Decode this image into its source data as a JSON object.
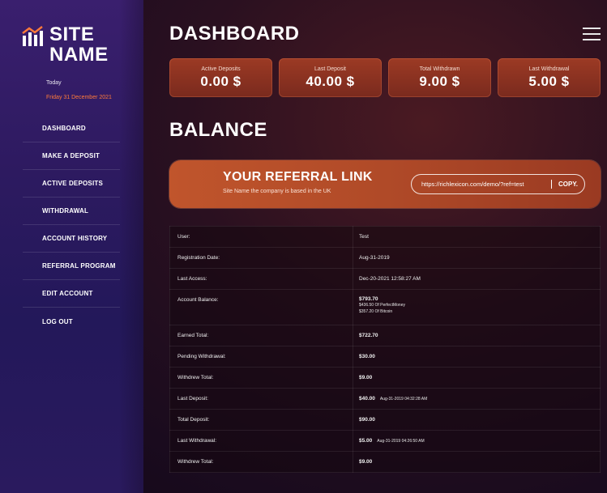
{
  "brand": {
    "line1": "SITE",
    "line2": "NAME"
  },
  "sidebar": {
    "today_label": "Today",
    "today_date": "Friday 31 December 2021",
    "items": [
      {
        "label": "DASHBOARD"
      },
      {
        "label": "MAKE A DEPOSIT"
      },
      {
        "label": "ACTIVE DEPOSITS"
      },
      {
        "label": "WITHDRAWAL"
      },
      {
        "label": "ACCOUNT HISTORY"
      },
      {
        "label": "REFERRAL PROGRAM"
      },
      {
        "label": "EDIT ACCOUNT"
      },
      {
        "label": "LOG OUT"
      }
    ]
  },
  "header": {
    "title": "DASHBOARD",
    "menu_icon": "hamburger-icon"
  },
  "stats": [
    {
      "label": "Active Deposits",
      "value": "0.00 $"
    },
    {
      "label": "Last Deposit",
      "value": "40.00 $"
    },
    {
      "label": "Total Withdrawn",
      "value": "9.00 $"
    },
    {
      "label": "Last Withdrawal",
      "value": "5.00 $"
    }
  ],
  "balance_title": "BALANCE",
  "referral": {
    "title": "YOUR REFERRAL LINK",
    "subtitle": "Site Name the company is based in the UK",
    "link": "https://richlexicon.com/demo/?ref=test",
    "copy_label": "COPY."
  },
  "account": {
    "rows": [
      {
        "label": "User:",
        "value": "Test"
      },
      {
        "label": "Registration Date:",
        "value": "Aug-31-2019"
      },
      {
        "label": "Last Access:",
        "value": "Dec-20-2021 12:58:27 AM"
      },
      {
        "label": "Account Balance:",
        "value": "$793.70",
        "lines": [
          "$436.50 Of PerfectMoney",
          "$357.20 Of Bitcoin"
        ]
      },
      {
        "label": "Earned Total:",
        "value": "$722.70"
      },
      {
        "label": "Pending Withdrawal:",
        "value": "$30.00"
      },
      {
        "label": "Withdrew Total:",
        "value": "$9.00"
      },
      {
        "label": "Last Deposit:",
        "value": "$40.00",
        "date": "Aug-31-2019 04:32:28 AM"
      },
      {
        "label": "Total Deposit:",
        "value": "$90.00"
      },
      {
        "label": "Last Withdrawal:",
        "value": "$5.00",
        "date": "Aug-31-2019 04:26:50 AM"
      },
      {
        "label": "Withdrew Total:",
        "value": "$9.00"
      }
    ]
  },
  "colors": {
    "sidebar": "#2d1a60",
    "accent": "#ff7a3a",
    "card": "#8a3220",
    "referral": "#b04a28"
  }
}
